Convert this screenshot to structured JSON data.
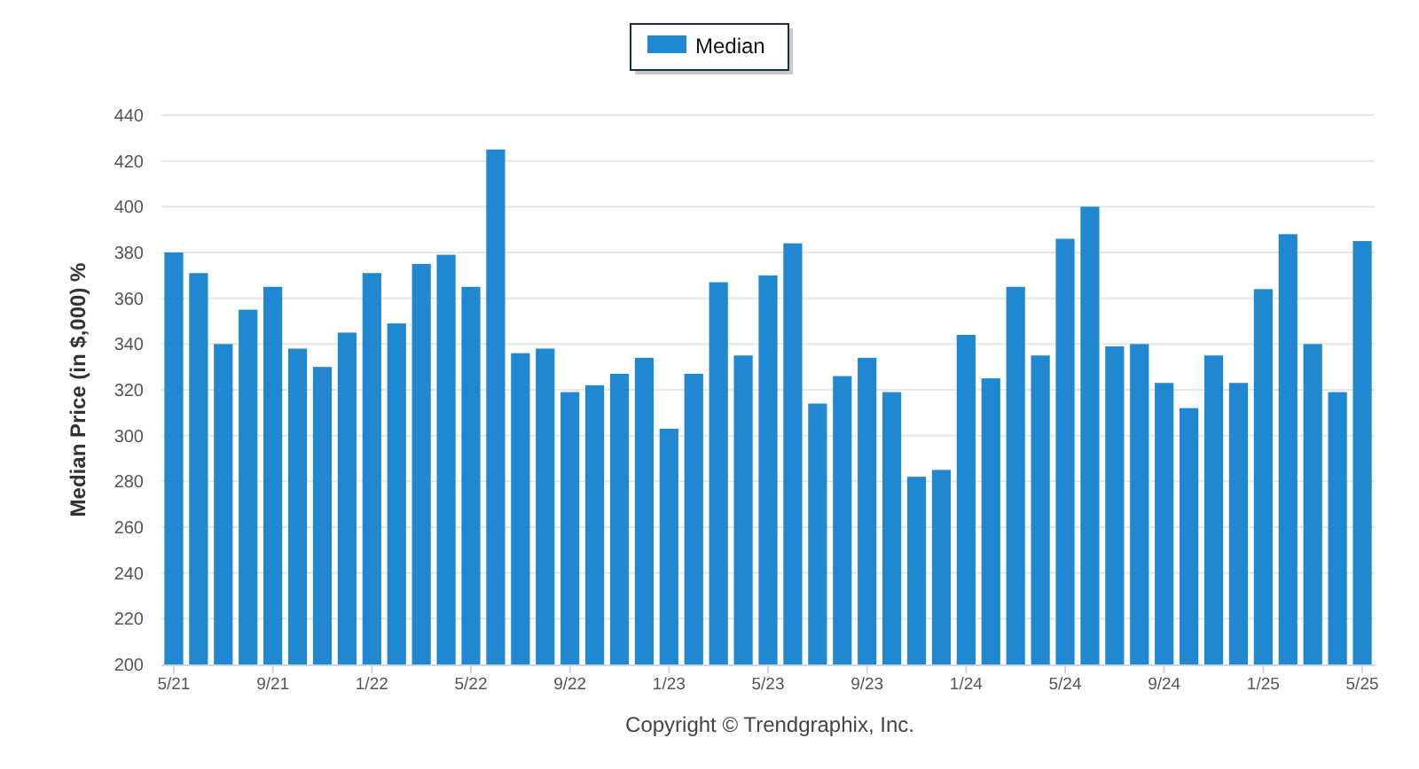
{
  "chart": {
    "chart_data": {
      "type": "bar",
      "ylabel": "Median Price (in $,000) %",
      "categories": [
        "5/21",
        null,
        null,
        null,
        "9/21",
        null,
        null,
        null,
        "1/22",
        null,
        null,
        null,
        "5/22",
        null,
        null,
        null,
        "9/22",
        null,
        null,
        null,
        "1/23",
        null,
        null,
        null,
        "5/23",
        null,
        null,
        null,
        "9/23",
        null,
        null,
        null,
        "1/24",
        null,
        null,
        null,
        "5/24",
        null,
        null,
        null,
        "9/24",
        null,
        null,
        null,
        "1/25",
        null,
        null,
        null,
        "5/25"
      ],
      "series": [
        {
          "name": "Median",
          "color": "#1f88d0",
          "values": [
            380,
            371,
            340,
            355,
            365,
            338,
            330,
            345,
            371,
            349,
            375,
            379,
            365,
            425,
            336,
            338,
            319,
            322,
            327,
            334,
            303,
            327,
            367,
            335,
            370,
            384,
            314,
            326,
            334,
            319,
            282,
            285,
            344,
            325,
            365,
            335,
            386,
            400,
            339,
            340,
            323,
            312,
            335,
            323,
            364,
            388,
            340,
            319,
            385
          ]
        }
      ],
      "ylim": [
        200,
        440
      ],
      "grid": true,
      "yticks": [
        200,
        220,
        240,
        260,
        280,
        300,
        320,
        340,
        360,
        380,
        400,
        420,
        440
      ]
    },
    "copyright": "Copyright © Trendgraphix, Inc."
  }
}
